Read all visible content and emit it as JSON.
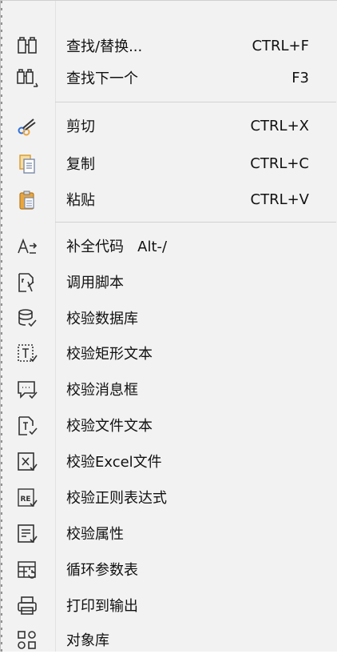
{
  "menu": {
    "groups": [
      {
        "items": [
          {
            "label": "查找/替换...",
            "shortcut": "CTRL+F",
            "icon": "binoculars-icon"
          },
          {
            "label": "查找下一个",
            "shortcut": "F3",
            "icon": "find-next-icon"
          }
        ]
      },
      {
        "items": [
          {
            "label": "剪切",
            "shortcut": "CTRL+X",
            "icon": "scissors-icon"
          },
          {
            "label": "复制",
            "shortcut": "CTRL+C",
            "icon": "copy-icon"
          },
          {
            "label": "粘贴",
            "shortcut": "CTRL+V",
            "icon": "paste-icon"
          }
        ]
      },
      {
        "items": [
          {
            "label": "补全代码",
            "shortcut_inline": "Alt-/",
            "icon": "autocomplete-icon"
          },
          {
            "label": "调用脚本",
            "icon": "call-script-icon"
          },
          {
            "label": "校验数据库",
            "icon": "verify-database-icon"
          },
          {
            "label": "校验矩形文本",
            "icon": "verify-rect-text-icon"
          },
          {
            "label": "校验消息框",
            "icon": "verify-messagebox-icon"
          },
          {
            "label": "校验文件文本",
            "icon": "verify-file-text-icon"
          },
          {
            "label": "校验Excel文件",
            "icon": "verify-excel-icon"
          },
          {
            "label": "校验正则表达式",
            "icon": "verify-regex-icon"
          },
          {
            "label": "校验属性",
            "icon": "verify-property-icon"
          },
          {
            "label": "循环参数表",
            "icon": "loop-table-icon"
          },
          {
            "label": "打印到输出",
            "icon": "printer-icon"
          },
          {
            "label": "对象库",
            "icon": "object-library-icon"
          }
        ]
      }
    ]
  },
  "colors": {
    "menu_bg": "#f2f2f2",
    "icon_stroke": "#333333",
    "accent_orange": "#e8a640",
    "accent_blue": "#2f6fd6"
  }
}
